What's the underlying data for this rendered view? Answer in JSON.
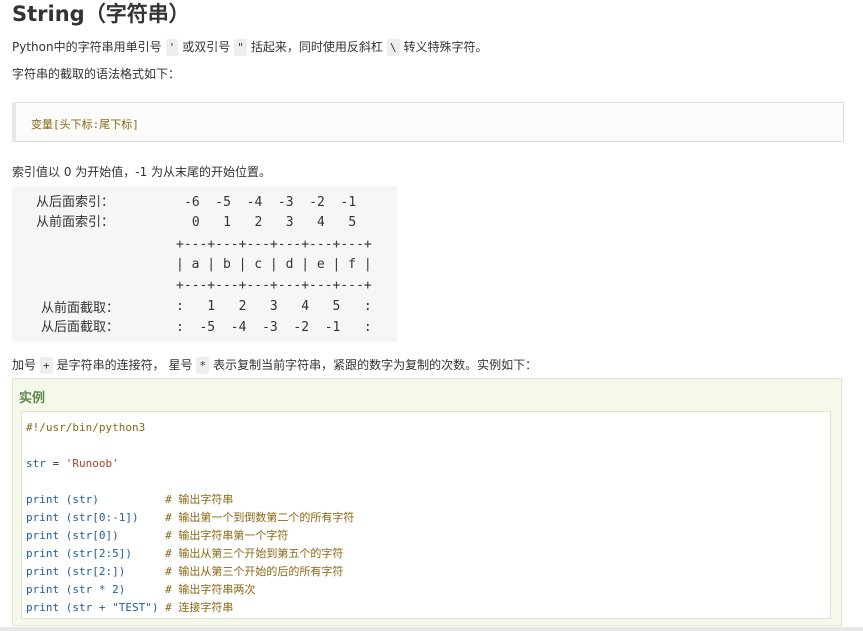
{
  "heading": "String（字符串）",
  "intro": {
    "before": "Python中的字符串用单引号",
    "single_quote": "'",
    "mid": "或双引号",
    "double_quote": "\"",
    "after_quotes": "括起来，同时使用反斜杠",
    "backslash": "\\",
    "end": "转义特殊字符。"
  },
  "syntax_intro": "字符串的截取的语法格式如下：",
  "syntax": "变量[头下标:尾下标]",
  "index_note": "索引值以 0 为开始值，-1 为从末尾的开始位置。",
  "index_diagram": {
    "back_index_label": "从后面索引：",
    "back_index_values": "-6  -5  -4  -3  -2  -1",
    "front_index_label": "从前面索引：",
    "front_index_values": " 0   1   2   3   4   5",
    "border": "+---+---+---+---+---+---+",
    "cells": "| a | b | c | d | e | f |",
    "front_slice_label": "从前面截取：",
    "front_slice_values": ":   1   2   3   4   5   :",
    "back_slice_label": "从后面截取：",
    "back_slice_values": ":  -5  -4  -3  -2  -1   :"
  },
  "concat_note": {
    "before": "加号",
    "plus": "+",
    "mid": "是字符串的连接符， 星号",
    "star": "*",
    "end": "表示复制当前字符串，紧跟的数字为复制的次数。实例如下："
  },
  "example": {
    "title": "实例",
    "shebang": "#!/usr/bin/python3",
    "assign_var": "str",
    "assign_op": " = ",
    "assign_val": "'Runoob'",
    "lines": [
      {
        "kw": "print",
        "args": " (str)          ",
        "comment": "# 输出字符串"
      },
      {
        "kw": "print",
        "args": " (str[0:-1])    ",
        "comment": "# 输出第一个到倒数第二个的所有字符"
      },
      {
        "kw": "print",
        "args": " (str[0])       ",
        "comment": "# 输出字符串第一个字符"
      },
      {
        "kw": "print",
        "args": " (str[2:5])     ",
        "comment": "# 输出从第三个开始到第五个的字符"
      },
      {
        "kw": "print",
        "args": " (str[2:])      ",
        "comment": "# 输出从第三个开始的后的所有字符"
      },
      {
        "kw": "print",
        "args": " (str * 2)      ",
        "comment": "# 输出字符串两次"
      },
      {
        "kw": "print",
        "args": " (str + \"TEST\") ",
        "comment": "# 连接字符串"
      }
    ]
  }
}
